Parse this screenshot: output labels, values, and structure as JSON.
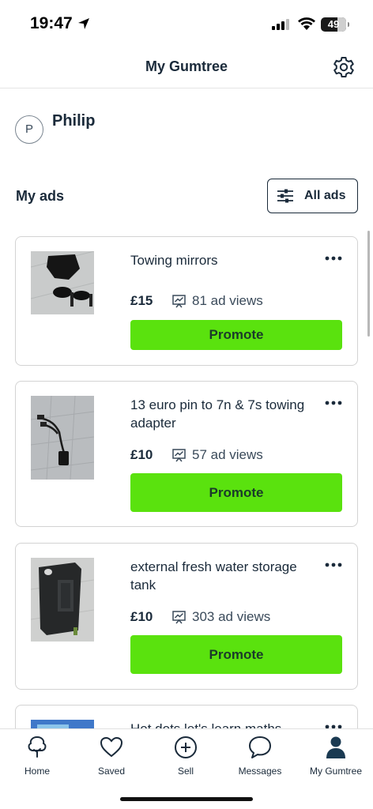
{
  "status_bar": {
    "time": "19:47",
    "battery": "49"
  },
  "header": {
    "title": "My Gumtree",
    "settings_icon": "gear-icon"
  },
  "profile": {
    "initial": "P",
    "name": "Philip"
  },
  "my_ads": {
    "label": "My ads",
    "filter_button": "All ads"
  },
  "ads": [
    {
      "title": "Towing mirrors",
      "price": "£15",
      "views": "81 ad views",
      "action": "Promote"
    },
    {
      "title": "13 euro pin to 7n & 7s towing adapter",
      "price": "£10",
      "views": "57 ad views",
      "action": "Promote"
    },
    {
      "title": "external fresh water storage tank",
      "price": "£10",
      "views": "303 ad views",
      "action": "Promote"
    },
    {
      "title": "Hot dots let's learn maths"
    }
  ],
  "bottom_nav": [
    {
      "label": "Home",
      "icon": "tree-icon"
    },
    {
      "label": "Saved",
      "icon": "heart-icon"
    },
    {
      "label": "Sell",
      "icon": "plus-circle-icon"
    },
    {
      "label": "Messages",
      "icon": "chat-bubble-icon"
    },
    {
      "label": "My Gumtree",
      "icon": "person-icon"
    }
  ],
  "colors": {
    "accent_green": "#5ae20e",
    "text_dark": "#1a2a3a",
    "border": "#d3d3d3"
  }
}
